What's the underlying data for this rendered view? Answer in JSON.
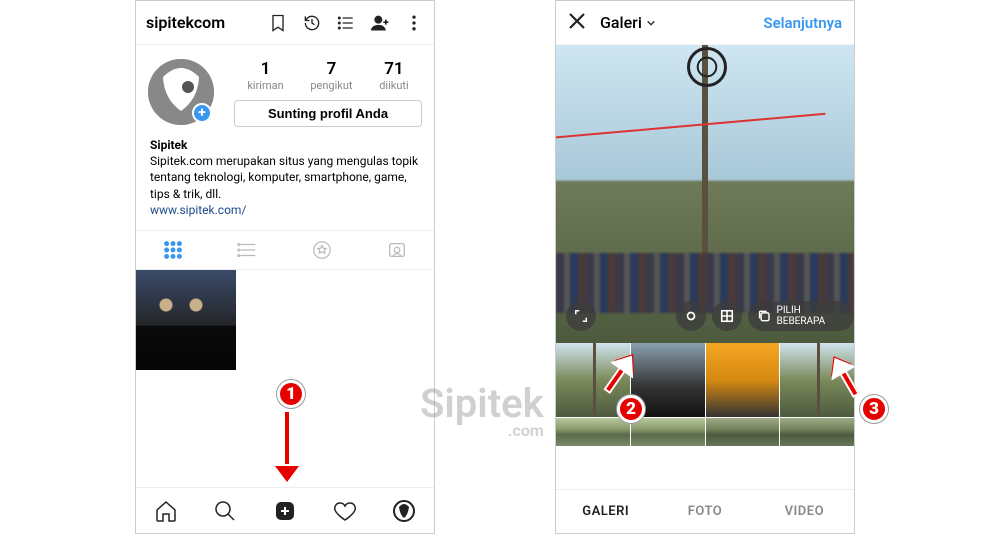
{
  "watermark": {
    "brand": "Sipitek",
    "suffix": ".com"
  },
  "callouts": {
    "one": "1",
    "two": "2",
    "three": "3"
  },
  "left": {
    "username": "sipitekcom",
    "stats": {
      "posts": {
        "value": "1",
        "label": "kiriman"
      },
      "followers": {
        "value": "7",
        "label": "pengikut"
      },
      "following": {
        "value": "71",
        "label": "diikuti"
      }
    },
    "edit_label": "Sunting profil Anda",
    "bio": {
      "name": "Sipitek",
      "text": "Sipitek.com merupakan situs yang mengulas topik tentang teknologi, komputer, smartphone, game, tips & trik, dll.",
      "url": "www.sipitek.com/"
    }
  },
  "right": {
    "title": "Galeri",
    "next_label": "Selanjutnya",
    "multi_label": "PILIH BEBERAPA",
    "tabs": {
      "gallery": "GALERI",
      "photo": "FOTO",
      "video": "VIDEO"
    }
  }
}
